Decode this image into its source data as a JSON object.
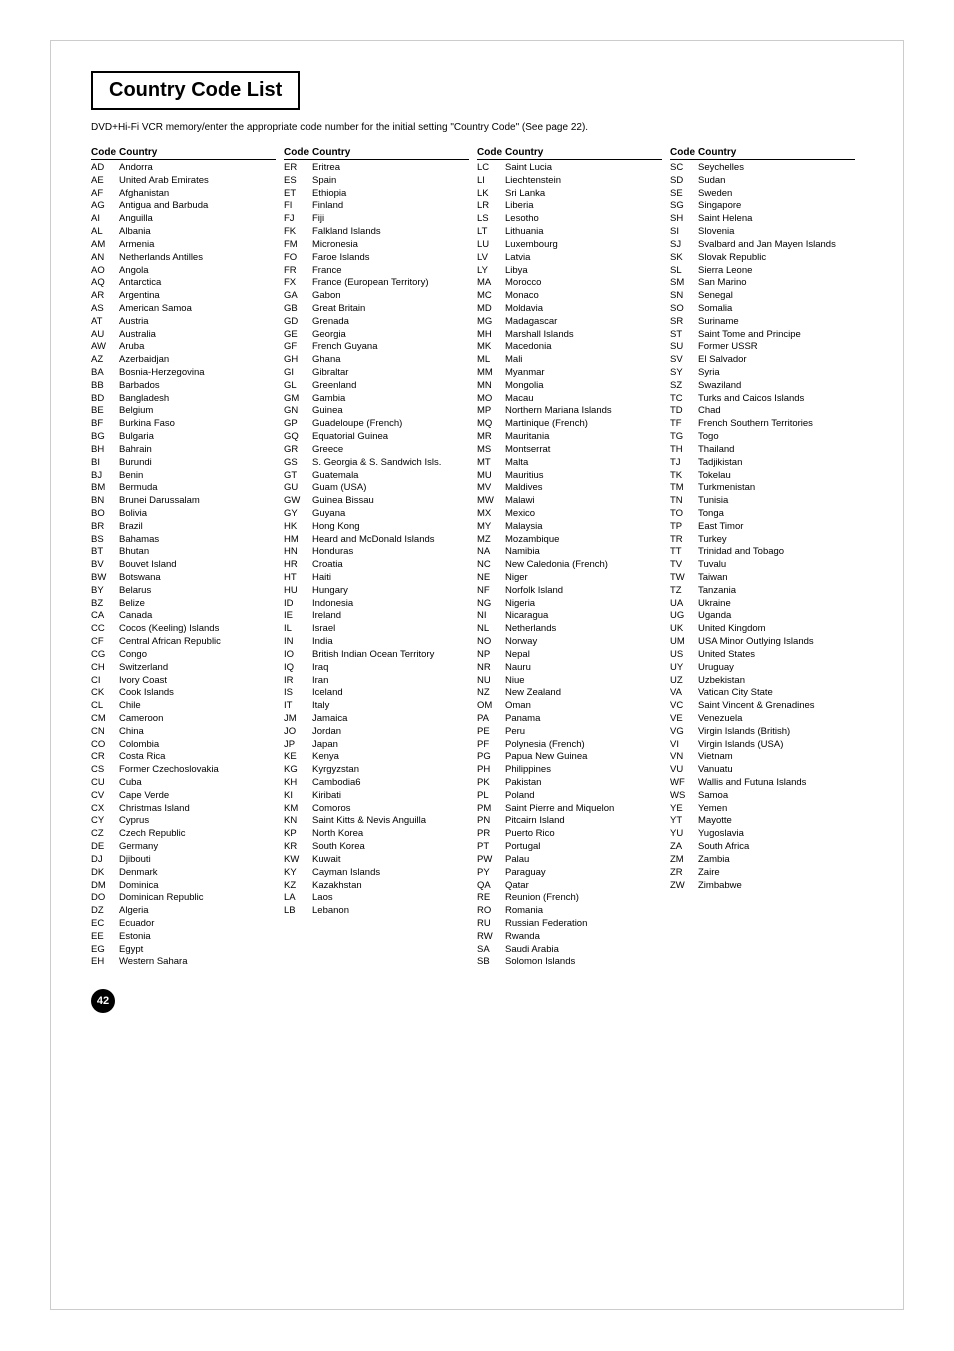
{
  "title": "Country Code List",
  "subtitle": "DVD+Hi-Fi VCR memory/enter the appropriate code number for the initial setting \"Country Code\" (See page 22).",
  "page_number": "42",
  "col_headers": [
    "Code",
    "Country"
  ],
  "columns": [
    [
      {
        "code": "AD",
        "country": "Andorra"
      },
      {
        "code": "AE",
        "country": "United Arab Emirates"
      },
      {
        "code": "AF",
        "country": "Afghanistan"
      },
      {
        "code": "AG",
        "country": "Antigua and Barbuda"
      },
      {
        "code": "AI",
        "country": "Anguilla"
      },
      {
        "code": "AL",
        "country": "Albania"
      },
      {
        "code": "AM",
        "country": "Armenia"
      },
      {
        "code": "AN",
        "country": "Netherlands Antilles"
      },
      {
        "code": "AO",
        "country": "Angola"
      },
      {
        "code": "AQ",
        "country": "Antarctica"
      },
      {
        "code": "AR",
        "country": "Argentina"
      },
      {
        "code": "AS",
        "country": "American Samoa"
      },
      {
        "code": "AT",
        "country": "Austria"
      },
      {
        "code": "AU",
        "country": "Australia"
      },
      {
        "code": "AW",
        "country": "Aruba"
      },
      {
        "code": "AZ",
        "country": "Azerbaidjan"
      },
      {
        "code": "BA",
        "country": "Bosnia-Herzegovina"
      },
      {
        "code": "BB",
        "country": "Barbados"
      },
      {
        "code": "BD",
        "country": "Bangladesh"
      },
      {
        "code": "BE",
        "country": "Belgium"
      },
      {
        "code": "BF",
        "country": "Burkina Faso"
      },
      {
        "code": "BG",
        "country": "Bulgaria"
      },
      {
        "code": "BH",
        "country": "Bahrain"
      },
      {
        "code": "BI",
        "country": "Burundi"
      },
      {
        "code": "BJ",
        "country": "Benin"
      },
      {
        "code": "BM",
        "country": "Bermuda"
      },
      {
        "code": "BN",
        "country": "Brunei Darussalam"
      },
      {
        "code": "BO",
        "country": "Bolivia"
      },
      {
        "code": "BR",
        "country": "Brazil"
      },
      {
        "code": "BS",
        "country": "Bahamas"
      },
      {
        "code": "BT",
        "country": "Bhutan"
      },
      {
        "code": "BV",
        "country": "Bouvet Island"
      },
      {
        "code": "BW",
        "country": "Botswana"
      },
      {
        "code": "BY",
        "country": "Belarus"
      },
      {
        "code": "BZ",
        "country": "Belize"
      },
      {
        "code": "CA",
        "country": "Canada"
      },
      {
        "code": "CC",
        "country": "Cocos (Keeling) Islands"
      },
      {
        "code": "CF",
        "country": "Central African Republic"
      },
      {
        "code": "CG",
        "country": "Congo"
      },
      {
        "code": "CH",
        "country": "Switzerland"
      },
      {
        "code": "CI",
        "country": "Ivory Coast"
      },
      {
        "code": "CK",
        "country": "Cook Islands"
      },
      {
        "code": "CL",
        "country": "Chile"
      },
      {
        "code": "CM",
        "country": "Cameroon"
      },
      {
        "code": "CN",
        "country": "China"
      },
      {
        "code": "CO",
        "country": "Colombia"
      },
      {
        "code": "CR",
        "country": "Costa Rica"
      },
      {
        "code": "CS",
        "country": "Former Czechoslovakia"
      },
      {
        "code": "CU",
        "country": "Cuba"
      },
      {
        "code": "CV",
        "country": "Cape Verde"
      },
      {
        "code": "CX",
        "country": "Christmas Island"
      },
      {
        "code": "CY",
        "country": "Cyprus"
      },
      {
        "code": "CZ",
        "country": "Czech Republic"
      },
      {
        "code": "DE",
        "country": "Germany"
      },
      {
        "code": "DJ",
        "country": "Djibouti"
      },
      {
        "code": "DK",
        "country": "Denmark"
      },
      {
        "code": "DM",
        "country": "Dominica"
      },
      {
        "code": "DO",
        "country": "Dominican Republic"
      },
      {
        "code": "DZ",
        "country": "Algeria"
      },
      {
        "code": "EC",
        "country": "Ecuador"
      },
      {
        "code": "EE",
        "country": "Estonia"
      },
      {
        "code": "EG",
        "country": "Egypt"
      },
      {
        "code": "EH",
        "country": "Western Sahara"
      }
    ],
    [
      {
        "code": "ER",
        "country": "Eritrea"
      },
      {
        "code": "ES",
        "country": "Spain"
      },
      {
        "code": "ET",
        "country": "Ethiopia"
      },
      {
        "code": "FI",
        "country": "Finland"
      },
      {
        "code": "FJ",
        "country": "Fiji"
      },
      {
        "code": "FK",
        "country": "Falkland Islands"
      },
      {
        "code": "FM",
        "country": "Micronesia"
      },
      {
        "code": "FO",
        "country": "Faroe Islands"
      },
      {
        "code": "FR",
        "country": "France"
      },
      {
        "code": "FX",
        "country": "France (European Territory)"
      },
      {
        "code": "GA",
        "country": "Gabon"
      },
      {
        "code": "GB",
        "country": "Great Britain"
      },
      {
        "code": "GD",
        "country": "Grenada"
      },
      {
        "code": "GE",
        "country": "Georgia"
      },
      {
        "code": "GF",
        "country": "French Guyana"
      },
      {
        "code": "GH",
        "country": "Ghana"
      },
      {
        "code": "GI",
        "country": "Gibraltar"
      },
      {
        "code": "GL",
        "country": "Greenland"
      },
      {
        "code": "GM",
        "country": "Gambia"
      },
      {
        "code": "GN",
        "country": "Guinea"
      },
      {
        "code": "GP",
        "country": "Guadeloupe (French)"
      },
      {
        "code": "GQ",
        "country": "Equatorial Guinea"
      },
      {
        "code": "GR",
        "country": "Greece"
      },
      {
        "code": "GS",
        "country": "S. Georgia & S. Sandwich Isls."
      },
      {
        "code": "GT",
        "country": "Guatemala"
      },
      {
        "code": "GU",
        "country": "Guam (USA)"
      },
      {
        "code": "GW",
        "country": "Guinea Bissau"
      },
      {
        "code": "GY",
        "country": "Guyana"
      },
      {
        "code": "HK",
        "country": "Hong Kong"
      },
      {
        "code": "HM",
        "country": "Heard and McDonald Islands"
      },
      {
        "code": "HN",
        "country": "Honduras"
      },
      {
        "code": "HR",
        "country": "Croatia"
      },
      {
        "code": "HT",
        "country": "Haiti"
      },
      {
        "code": "HU",
        "country": "Hungary"
      },
      {
        "code": "ID",
        "country": "Indonesia"
      },
      {
        "code": "IE",
        "country": "Ireland"
      },
      {
        "code": "IL",
        "country": "Israel"
      },
      {
        "code": "IN",
        "country": "India"
      },
      {
        "code": "IO",
        "country": "British Indian Ocean Territory"
      },
      {
        "code": "IQ",
        "country": "Iraq"
      },
      {
        "code": "IR",
        "country": "Iran"
      },
      {
        "code": "IS",
        "country": "Iceland"
      },
      {
        "code": "IT",
        "country": "Italy"
      },
      {
        "code": "JM",
        "country": "Jamaica"
      },
      {
        "code": "JO",
        "country": "Jordan"
      },
      {
        "code": "JP",
        "country": "Japan"
      },
      {
        "code": "KE",
        "country": "Kenya"
      },
      {
        "code": "KG",
        "country": "Kyrgyzstan"
      },
      {
        "code": "KH",
        "country": "Cambodia6"
      },
      {
        "code": "KI",
        "country": "Kiribati"
      },
      {
        "code": "KM",
        "country": "Comoros"
      },
      {
        "code": "KN",
        "country": "Saint Kitts & Nevis Anguilla"
      },
      {
        "code": "KP",
        "country": "North Korea"
      },
      {
        "code": "KR",
        "country": "South Korea"
      },
      {
        "code": "KW",
        "country": "Kuwait"
      },
      {
        "code": "KY",
        "country": "Cayman Islands"
      },
      {
        "code": "KZ",
        "country": "Kazakhstan"
      },
      {
        "code": "LA",
        "country": "Laos"
      },
      {
        "code": "LB",
        "country": "Lebanon"
      }
    ],
    [
      {
        "code": "LC",
        "country": "Saint Lucia"
      },
      {
        "code": "LI",
        "country": "Liechtenstein"
      },
      {
        "code": "LK",
        "country": "Sri Lanka"
      },
      {
        "code": "LR",
        "country": "Liberia"
      },
      {
        "code": "LS",
        "country": "Lesotho"
      },
      {
        "code": "LT",
        "country": "Lithuania"
      },
      {
        "code": "LU",
        "country": "Luxembourg"
      },
      {
        "code": "LV",
        "country": "Latvia"
      },
      {
        "code": "LY",
        "country": "Libya"
      },
      {
        "code": "MA",
        "country": "Morocco"
      },
      {
        "code": "MC",
        "country": "Monaco"
      },
      {
        "code": "MD",
        "country": "Moldavia"
      },
      {
        "code": "MG",
        "country": "Madagascar"
      },
      {
        "code": "MH",
        "country": "Marshall Islands"
      },
      {
        "code": "MK",
        "country": "Macedonia"
      },
      {
        "code": "ML",
        "country": "Mali"
      },
      {
        "code": "MM",
        "country": "Myanmar"
      },
      {
        "code": "MN",
        "country": "Mongolia"
      },
      {
        "code": "MO",
        "country": "Macau"
      },
      {
        "code": "MP",
        "country": "Northern Mariana Islands"
      },
      {
        "code": "MQ",
        "country": "Martinique (French)"
      },
      {
        "code": "MR",
        "country": "Mauritania"
      },
      {
        "code": "MS",
        "country": "Montserrat"
      },
      {
        "code": "MT",
        "country": "Malta"
      },
      {
        "code": "MU",
        "country": "Mauritius"
      },
      {
        "code": "MV",
        "country": "Maldives"
      },
      {
        "code": "MW",
        "country": "Malawi"
      },
      {
        "code": "MX",
        "country": "Mexico"
      },
      {
        "code": "MY",
        "country": "Malaysia"
      },
      {
        "code": "MZ",
        "country": "Mozambique"
      },
      {
        "code": "NA",
        "country": "Namibia"
      },
      {
        "code": "NC",
        "country": "New Caledonia (French)"
      },
      {
        "code": "NE",
        "country": "Niger"
      },
      {
        "code": "NF",
        "country": "Norfolk Island"
      },
      {
        "code": "NG",
        "country": "Nigeria"
      },
      {
        "code": "NI",
        "country": "Nicaragua"
      },
      {
        "code": "NL",
        "country": "Netherlands"
      },
      {
        "code": "NO",
        "country": "Norway"
      },
      {
        "code": "NP",
        "country": "Nepal"
      },
      {
        "code": "NR",
        "country": "Nauru"
      },
      {
        "code": "NU",
        "country": "Niue"
      },
      {
        "code": "NZ",
        "country": "New Zealand"
      },
      {
        "code": "OM",
        "country": "Oman"
      },
      {
        "code": "PA",
        "country": "Panama"
      },
      {
        "code": "PE",
        "country": "Peru"
      },
      {
        "code": "PF",
        "country": "Polynesia (French)"
      },
      {
        "code": "PG",
        "country": "Papua New Guinea"
      },
      {
        "code": "PH",
        "country": "Philippines"
      },
      {
        "code": "PK",
        "country": "Pakistan"
      },
      {
        "code": "PL",
        "country": "Poland"
      },
      {
        "code": "PM",
        "country": "Saint Pierre and Miquelon"
      },
      {
        "code": "PN",
        "country": "Pitcairn Island"
      },
      {
        "code": "PR",
        "country": "Puerto Rico"
      },
      {
        "code": "PT",
        "country": "Portugal"
      },
      {
        "code": "PW",
        "country": "Palau"
      },
      {
        "code": "PY",
        "country": "Paraguay"
      },
      {
        "code": "QA",
        "country": "Qatar"
      },
      {
        "code": "RE",
        "country": "Reunion (French)"
      },
      {
        "code": "RO",
        "country": "Romania"
      },
      {
        "code": "RU",
        "country": "Russian Federation"
      },
      {
        "code": "RW",
        "country": "Rwanda"
      },
      {
        "code": "SA",
        "country": "Saudi Arabia"
      },
      {
        "code": "SB",
        "country": "Solomon Islands"
      }
    ],
    [
      {
        "code": "SC",
        "country": "Seychelles"
      },
      {
        "code": "SD",
        "country": "Sudan"
      },
      {
        "code": "SE",
        "country": "Sweden"
      },
      {
        "code": "SG",
        "country": "Singapore"
      },
      {
        "code": "SH",
        "country": "Saint Helena"
      },
      {
        "code": "SI",
        "country": "Slovenia"
      },
      {
        "code": "SJ",
        "country": "Svalbard and Jan Mayen Islands"
      },
      {
        "code": "SK",
        "country": "Slovak Republic"
      },
      {
        "code": "SL",
        "country": "Sierra Leone"
      },
      {
        "code": "SM",
        "country": "San Marino"
      },
      {
        "code": "SN",
        "country": "Senegal"
      },
      {
        "code": "SO",
        "country": "Somalia"
      },
      {
        "code": "SR",
        "country": "Suriname"
      },
      {
        "code": "ST",
        "country": "Saint Tome and Principe"
      },
      {
        "code": "SU",
        "country": "Former USSR"
      },
      {
        "code": "SV",
        "country": "El Salvador"
      },
      {
        "code": "SY",
        "country": "Syria"
      },
      {
        "code": "SZ",
        "country": "Swaziland"
      },
      {
        "code": "TC",
        "country": "Turks and Caicos Islands"
      },
      {
        "code": "TD",
        "country": "Chad"
      },
      {
        "code": "TF",
        "country": "French Southern Territories"
      },
      {
        "code": "TG",
        "country": "Togo"
      },
      {
        "code": "TH",
        "country": "Thailand"
      },
      {
        "code": "TJ",
        "country": "Tadjikistan"
      },
      {
        "code": "TK",
        "country": "Tokelau"
      },
      {
        "code": "TM",
        "country": "Turkmenistan"
      },
      {
        "code": "TN",
        "country": "Tunisia"
      },
      {
        "code": "TO",
        "country": "Tonga"
      },
      {
        "code": "TP",
        "country": "East Timor"
      },
      {
        "code": "TR",
        "country": "Turkey"
      },
      {
        "code": "TT",
        "country": "Trinidad and Tobago"
      },
      {
        "code": "TV",
        "country": "Tuvalu"
      },
      {
        "code": "TW",
        "country": "Taiwan"
      },
      {
        "code": "TZ",
        "country": "Tanzania"
      },
      {
        "code": "UA",
        "country": "Ukraine"
      },
      {
        "code": "UG",
        "country": "Uganda"
      },
      {
        "code": "UK",
        "country": "United Kingdom"
      },
      {
        "code": "UM",
        "country": "USA Minor Outlying Islands"
      },
      {
        "code": "US",
        "country": "United States"
      },
      {
        "code": "UY",
        "country": "Uruguay"
      },
      {
        "code": "UZ",
        "country": "Uzbekistan"
      },
      {
        "code": "VA",
        "country": "Vatican City State"
      },
      {
        "code": "VC",
        "country": "Saint Vincent & Grenadines"
      },
      {
        "code": "VE",
        "country": "Venezuela"
      },
      {
        "code": "VG",
        "country": "Virgin Islands (British)"
      },
      {
        "code": "VI",
        "country": "Virgin Islands (USA)"
      },
      {
        "code": "VN",
        "country": "Vietnam"
      },
      {
        "code": "VU",
        "country": "Vanuatu"
      },
      {
        "code": "WF",
        "country": "Wallis and Futuna Islands"
      },
      {
        "code": "WS",
        "country": "Samoa"
      },
      {
        "code": "YE",
        "country": "Yemen"
      },
      {
        "code": "YT",
        "country": "Mayotte"
      },
      {
        "code": "YU",
        "country": "Yugoslavia"
      },
      {
        "code": "ZA",
        "country": "South Africa"
      },
      {
        "code": "ZM",
        "country": "Zambia"
      },
      {
        "code": "ZR",
        "country": "Zaire"
      },
      {
        "code": "ZW",
        "country": "Zimbabwe"
      }
    ]
  ]
}
